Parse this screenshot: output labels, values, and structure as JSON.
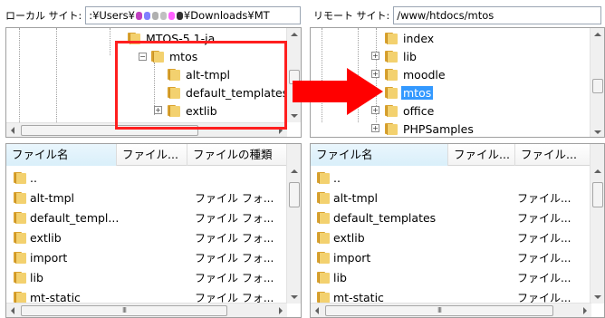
{
  "left": {
    "site_label": "ローカル サイト:",
    "site_path_prefix": ":¥Users¥",
    "site_path_suffix": "¥Downloads¥MT",
    "tree": [
      {
        "label": "MTOS-5.1-ja",
        "expander": "",
        "selected": false
      },
      {
        "label": "mtos",
        "expander": "−",
        "selected": false
      },
      {
        "label": "alt-tmpl",
        "expander": "",
        "selected": false
      },
      {
        "label": "default_templates",
        "expander": "",
        "selected": false
      },
      {
        "label": "extlib",
        "expander": "+",
        "selected": false
      }
    ],
    "columns": [
      "ファイル名",
      "ファイル...",
      "ファイルの種類"
    ],
    "files": [
      {
        "name": "..",
        "type": ""
      },
      {
        "name": "alt-tmpl",
        "type": "ファイル フォ..."
      },
      {
        "name": "default_templ...",
        "type": "ファイル フォ..."
      },
      {
        "name": "extlib",
        "type": "ファイル フォ..."
      },
      {
        "name": "import",
        "type": "ファイル フォ..."
      },
      {
        "name": "lib",
        "type": "ファイル フォ..."
      },
      {
        "name": "mt-static",
        "type": "ファイル フォ..."
      }
    ]
  },
  "right": {
    "site_label": "リモート サイト:",
    "site_path": "/www/htdocs/mtos",
    "tree": [
      {
        "label": "index",
        "expander": "",
        "selected": false
      },
      {
        "label": "lib",
        "expander": "+",
        "selected": false
      },
      {
        "label": "moodle",
        "expander": "+",
        "selected": false
      },
      {
        "label": "mtos",
        "expander": "",
        "selected": true
      },
      {
        "label": "office",
        "expander": "+",
        "selected": false
      },
      {
        "label": "PHPSamples",
        "expander": "+",
        "selected": false
      }
    ],
    "columns": [
      "ファイル名",
      "ファイル...",
      "ファイル..."
    ],
    "files": [
      {
        "name": "..",
        "type": ""
      },
      {
        "name": "alt-tmpl",
        "type": "ファイル..."
      },
      {
        "name": "default_templates",
        "type": "ファイル..."
      },
      {
        "name": "extlib",
        "type": "ファイル..."
      },
      {
        "name": "import",
        "type": "ファイル..."
      },
      {
        "name": "lib",
        "type": "ファイル..."
      },
      {
        "name": "mt-static",
        "type": "ファイル..."
      }
    ]
  },
  "scroll_thumb_glyph": "III",
  "colors": {
    "highlight": "#ff1f1f",
    "arrow": "#ff0000",
    "selection": "#3399ff",
    "folder": "#f3d16f",
    "blur_dots": [
      "#c040c0",
      "#8080ff",
      "#b0b0b0",
      "#c0c0c0",
      "#ff60ff",
      "#303030"
    ]
  }
}
